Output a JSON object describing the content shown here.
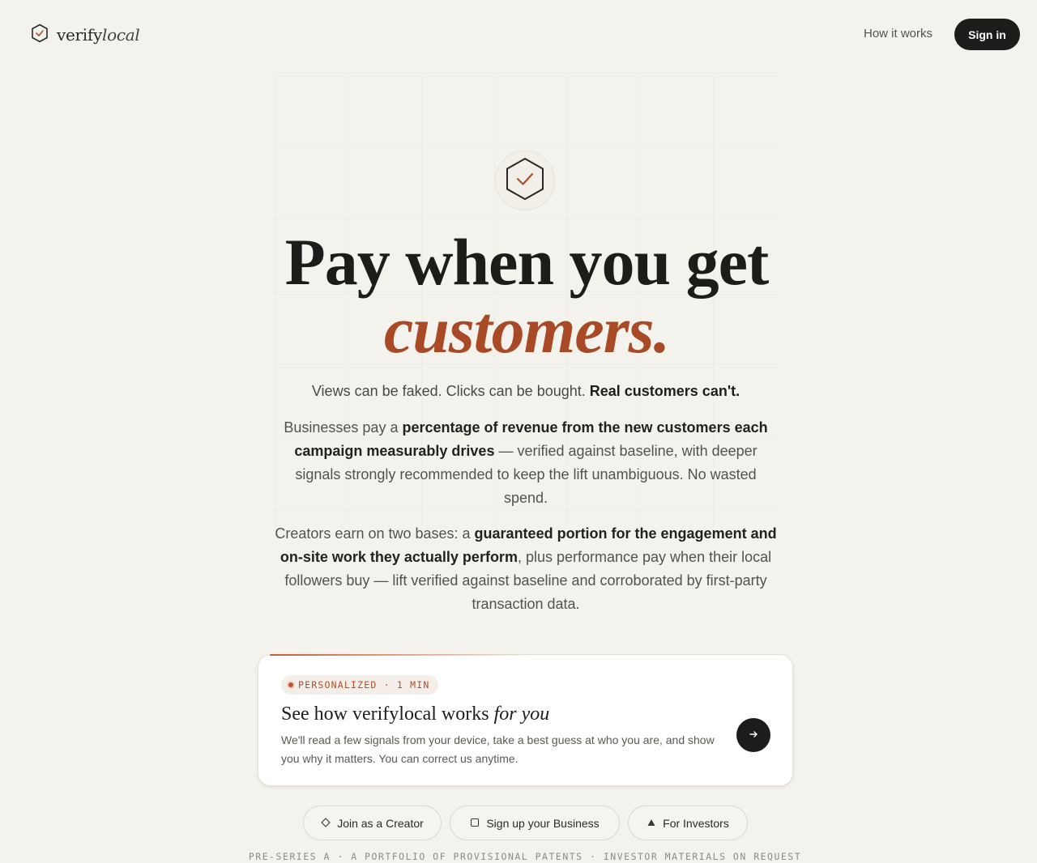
{
  "header": {
    "brand_prefix": "verify",
    "brand_suffix": "local",
    "nav_how": "How it works",
    "sign_in": "Sign in"
  },
  "hero": {
    "headline_line1": "Pay when you get",
    "headline_line2": "customers.",
    "tagline_lead": "Views can be faked. Clicks can be bought. ",
    "tagline_bold": "Real customers can't.",
    "para1": {
      "a": "Businesses pay a ",
      "b": "percentage of revenue from the new customers each campaign measurably drives",
      "c": " — verified against baseline, with deeper signals strongly recommended to keep the lift unambiguous. No wasted spend."
    },
    "para2": {
      "a": "Creators earn on two bases: a ",
      "b": "guaranteed portion for the engagement and on-site work they actually perform",
      "c": ", plus performance pay when their local followers buy — lift verified against baseline and corroborated by first-party transaction data."
    }
  },
  "card": {
    "tag": "PERSONALIZED · 1 MIN",
    "title_lead": "See how verifylocal works ",
    "title_em": "for you",
    "description": "We'll read a few signals from your device, take a best guess at who you are, and show you why it matters. You can correct us anytime."
  },
  "actions": {
    "creator": "Join as a Creator",
    "business": "Sign up your Business",
    "investors": "For Investors"
  },
  "footer": {
    "line": "PRE-SERIES A · A PORTFOLIO OF PROVISIONAL PATENTS · INVESTOR MATERIALS ON REQUEST"
  },
  "colors": {
    "background": "#f4f2ed",
    "accent": "#a84a26",
    "dark": "#1d1c1a"
  }
}
